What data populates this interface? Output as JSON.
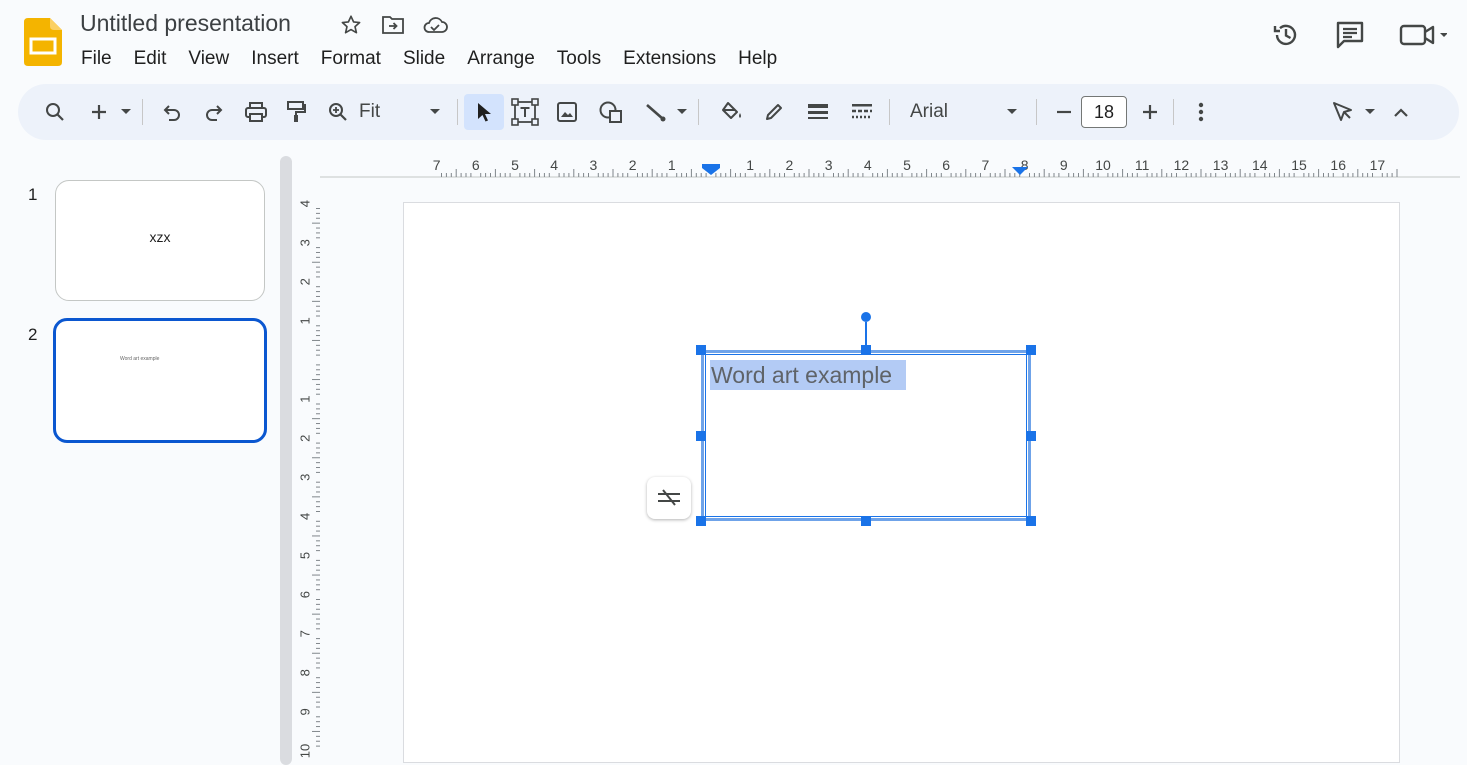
{
  "app": {
    "title": "Untitled presentation",
    "accent": "#0b57d0",
    "logo_color": "#f4b400"
  },
  "menu": [
    "File",
    "Edit",
    "View",
    "Insert",
    "Format",
    "Slide",
    "Arrange",
    "Tools",
    "Extensions",
    "Help"
  ],
  "toolbar": {
    "zoom": "Fit",
    "font": "Arial",
    "font_size": "18"
  },
  "filmstrip": {
    "slides": [
      {
        "number": "1",
        "text": "xzx",
        "selected": false
      },
      {
        "number": "2",
        "text": "Word art example",
        "selected": true
      }
    ]
  },
  "rulers": {
    "horizontal": [
      "7",
      "6",
      "5",
      "4",
      "3",
      "2",
      "1",
      "1",
      "2",
      "3",
      "4",
      "5",
      "6",
      "7",
      "8",
      "9",
      "10",
      "11",
      "12",
      "13",
      "14",
      "15",
      "16",
      "17"
    ],
    "vertical": [
      "4",
      "3",
      "2",
      "1",
      "1",
      "2",
      "3",
      "4",
      "5",
      "6",
      "7",
      "8",
      "9",
      "10"
    ]
  },
  "canvas": {
    "textbox_text": "Word art example",
    "selection_color": "#1a73e8",
    "highlight_color": "#b3cbf5"
  }
}
